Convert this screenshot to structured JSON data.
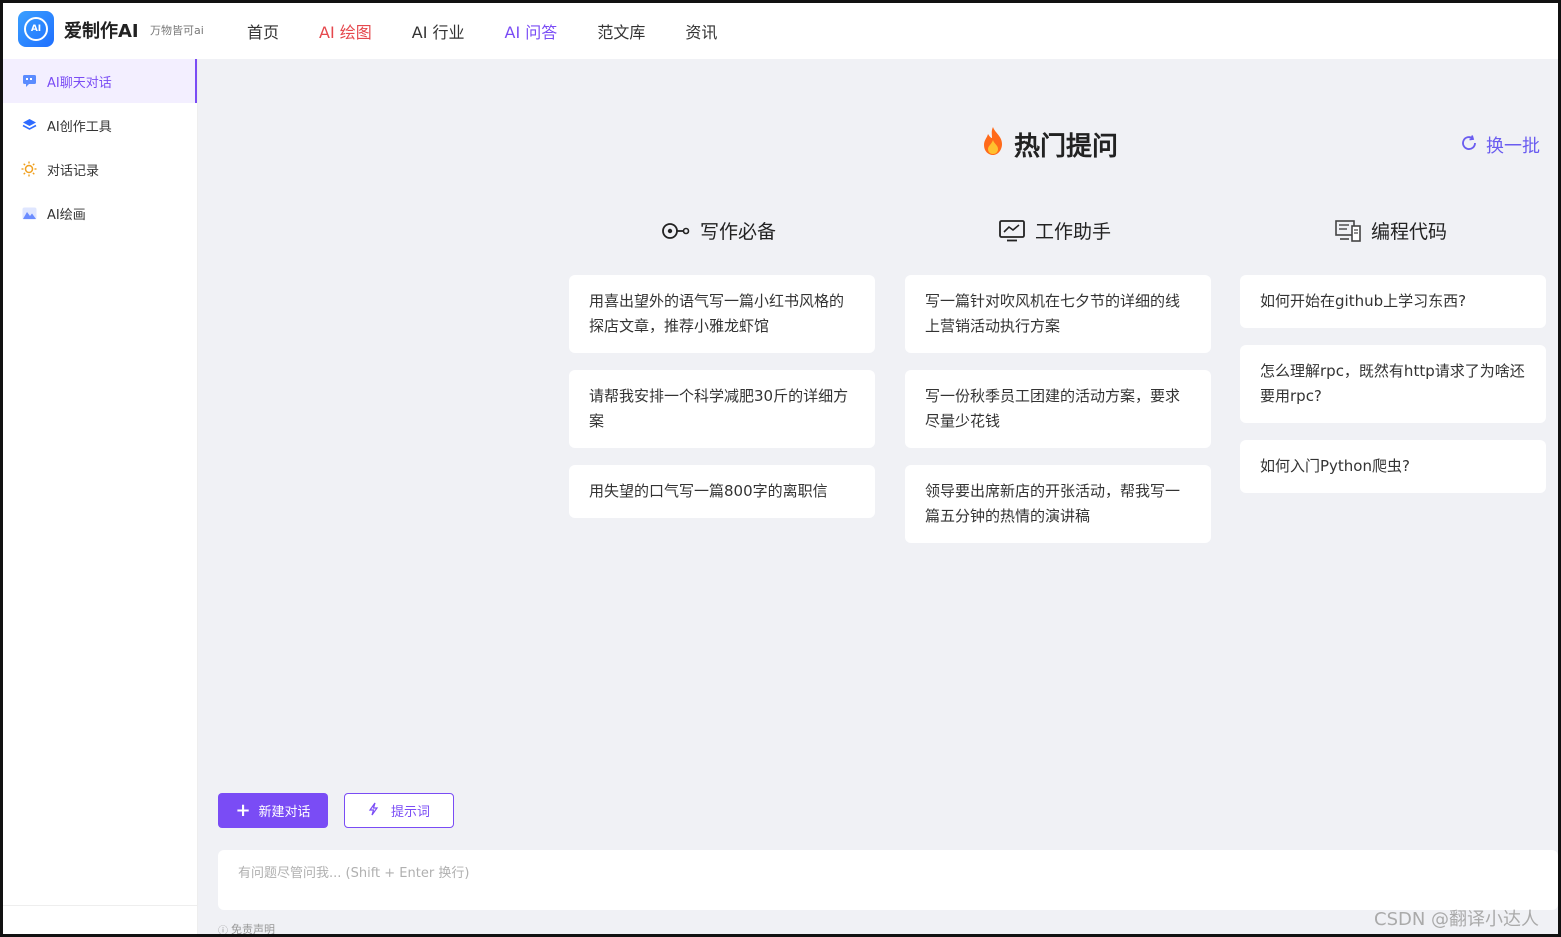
{
  "header": {
    "logo_text": "AI",
    "brand": "爱制作AI",
    "slogan": "万物皆可ai",
    "nav": [
      "首页",
      "AI 绘图",
      "AI 行业",
      "AI 问答",
      "范文库",
      "资讯"
    ]
  },
  "sidebar": {
    "items": [
      {
        "label": "AI聊天对话",
        "icon": "chat-icon",
        "active": true
      },
      {
        "label": "AI创作工具",
        "icon": "layers-icon",
        "active": false
      },
      {
        "label": "对话记录",
        "icon": "bulb-icon",
        "active": false
      },
      {
        "label": "AI绘画",
        "icon": "image-icon",
        "active": false
      }
    ]
  },
  "main": {
    "hot_title": "热门提问",
    "refresh_label": "换一批",
    "columns": [
      {
        "title": "写作必备",
        "icon": "pen-icon",
        "items": [
          "用喜出望外的语气写一篇小红书风格的探店文章，推荐小雅龙虾馆",
          "请帮我安排一个科学减肥30斤的详细方案",
          "用失望的口气写一篇800字的离职信"
        ]
      },
      {
        "title": "工作助手",
        "icon": "monitor-icon",
        "items": [
          "写一篇针对吹风机在七夕节的详细的线上营销活动执行方案",
          "写一份秋季员工团建的活动方案，要求尽量少花钱",
          "领导要出席新店的开张活动，帮我写一篇五分钟的热情的演讲稿"
        ]
      },
      {
        "title": "编程代码",
        "icon": "code-icon",
        "items": [
          "如何开始在github上学习东西?",
          "怎么理解rpc，既然有http请求了为啥还要用rpc?",
          "如何入门Python爬虫?"
        ]
      }
    ],
    "new_chat_label": "新建对话",
    "prompt_label": "提示词",
    "input_placeholder": "有问题尽管问我... (Shift + Enter 换行)",
    "disclaimer": "免责声明"
  },
  "watermark": "CSDN @翻译小达人",
  "colors": {
    "accent": "#7a4cf5",
    "nav_red": "#e5484d",
    "background": "#f0f1f5"
  }
}
